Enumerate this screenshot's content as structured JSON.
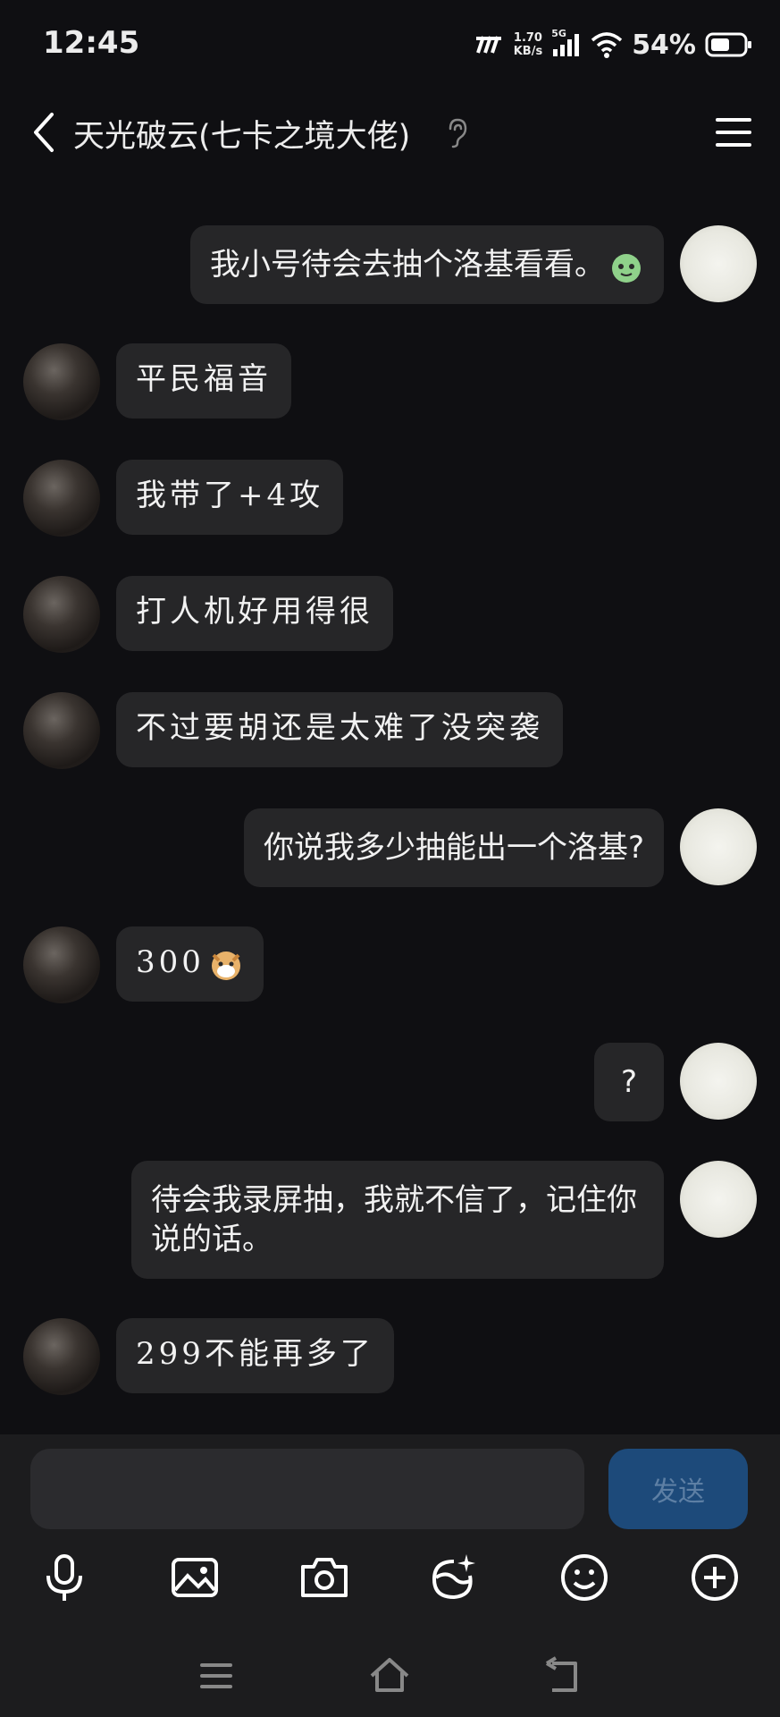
{
  "status_bar": {
    "time": "12:45",
    "net_speed_value": "1.70",
    "net_speed_unit": "KB/s",
    "network": "5G",
    "battery": "54%"
  },
  "header": {
    "title": "天光破云(七卡之境大佬)",
    "icons": [
      "back-icon",
      "ear-icon",
      "menu-icon"
    ]
  },
  "messages": [
    {
      "side": "right",
      "text": "我小号待会去抽个洛基看看。"
    },
    {
      "side": "left",
      "text": "平民福音"
    },
    {
      "side": "left",
      "text": "我带了+4攻"
    },
    {
      "side": "left",
      "text": "打人机好用得很"
    },
    {
      "side": "left",
      "text": "不过要胡还是太难了没突袭"
    },
    {
      "side": "right",
      "text": "你说我多少抽能出一个洛基?"
    },
    {
      "side": "left",
      "text": "300"
    },
    {
      "side": "right",
      "text": "?"
    },
    {
      "side": "right",
      "text": "待会我录屏抽，我就不信了，记住你说的话。"
    },
    {
      "side": "left",
      "text": "299不能再多了"
    }
  ],
  "input": {
    "value": "",
    "send_label": "发送"
  },
  "toolbar": [
    "microphone-icon",
    "image-icon",
    "camera-icon",
    "face-sparkle-icon",
    "smiley-icon",
    "plus-icon"
  ],
  "colors": {
    "background": "#0f0f12",
    "bubble": "#262628",
    "send_button": "#1d4a7a",
    "send_text": "#5d7fa4"
  }
}
